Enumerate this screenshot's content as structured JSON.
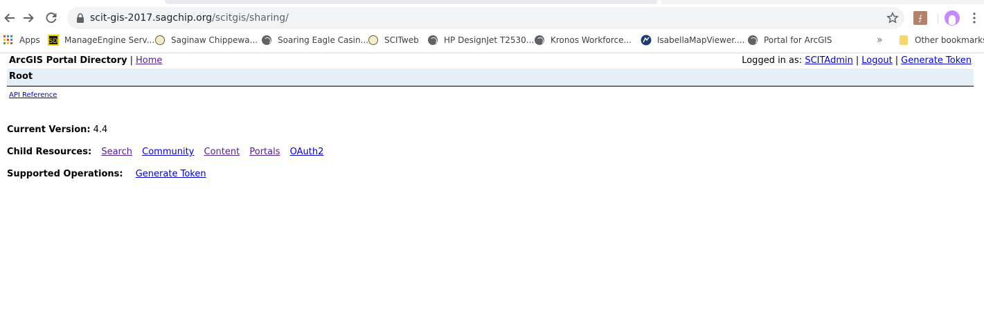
{
  "browser": {
    "url_host": "scit-gis-2017.sagchip.org",
    "url_path": "/scitgis/sharing/",
    "icons": {
      "back": "arrow-left-icon",
      "forward": "arrow-right-icon",
      "reload": "reload-icon",
      "lock": "lock-icon",
      "star": "star-icon",
      "pdf": "pdf-extension-icon",
      "profile": "profile-avatar-icon",
      "menu": "more-vert-icon"
    },
    "bookmarks": [
      {
        "label": "Apps",
        "icon": "apps-grid-icon"
      },
      {
        "label": "ManageEngine Serv...",
        "icon": "manageengine-icon"
      },
      {
        "label": "Saginaw Chippewa...",
        "icon": "seal-icon"
      },
      {
        "label": "Soaring Eagle Casin...",
        "icon": "globe-icon"
      },
      {
        "label": "SCITweb",
        "icon": "seal-icon"
      },
      {
        "label": "HP DesignJet T2530...",
        "icon": "globe-icon"
      },
      {
        "label": "Kronos Workforce...",
        "icon": "globe-icon"
      },
      {
        "label": "IsabellaMapViewer....",
        "icon": "map-viewer-icon"
      },
      {
        "label": "Portal for ArcGIS",
        "icon": "globe-icon"
      }
    ],
    "overflow": "»",
    "other_bookmarks": "Other bookmarks"
  },
  "page": {
    "title": "ArcGIS Portal Directory",
    "home": "Home",
    "logged_in_label": "Logged in as:",
    "user": "SCITAdmin",
    "logout": "Logout",
    "generate_token_top": "Generate Token",
    "pipe": "|",
    "breadcrumb": "Root",
    "api_reference": "API Reference",
    "current_version_label": "Current Version:",
    "current_version": "4.4",
    "child_resources_label": "Child Resources:",
    "child_resources": [
      "Search",
      "Community",
      "Content",
      "Portals",
      "OAuth2"
    ],
    "supported_operations_label": "Supported Operations:",
    "supported_operations": [
      "Generate Token"
    ]
  },
  "colors": {
    "link": "#0000cc",
    "visited_link": "#551a8b",
    "breadcrumb_bg": "#e5eff7"
  }
}
